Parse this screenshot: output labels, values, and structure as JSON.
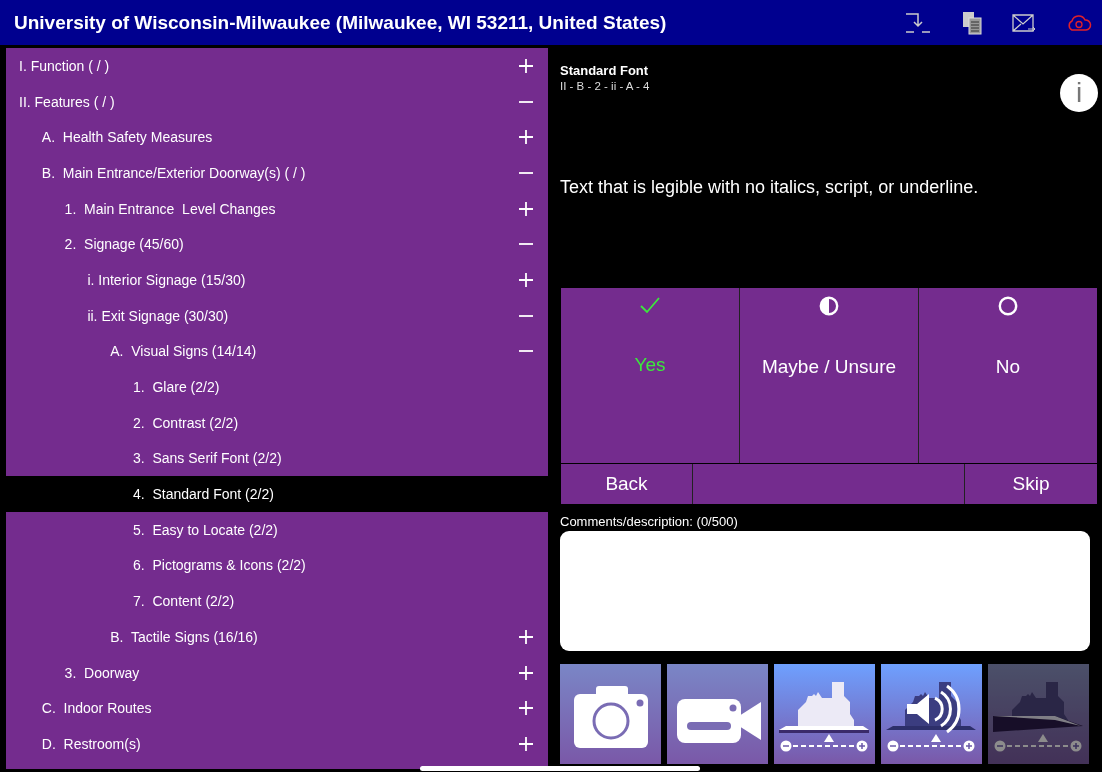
{
  "header": {
    "title": "University of Wisconsin-Milwaukee (Milwaukee, WI 53211, United States)",
    "tools": [
      {
        "kind": "import"
      },
      {
        "kind": "copy"
      },
      {
        "kind": "mail"
      },
      {
        "kind": "sync",
        "alert": true
      }
    ]
  },
  "outline": [
    {
      "label": "I. Function ( / )",
      "expanded": false,
      "selected": false
    },
    {
      "label": "II. Features ( / )",
      "expanded": true,
      "selected": false,
      "children": [
        {
          "label": "A.  Health Safety Measures",
          "expanded": false,
          "selected": false
        },
        {
          "label": "B.  Main Entrance/Exterior Doorway(s) ( / )",
          "expanded": true,
          "selected": false,
          "children": [
            {
              "label": "1.  Main Entrance  Level Changes",
              "expanded": false,
              "selected": false
            },
            {
              "label": "2.  Signage (45/60)",
              "expanded": true,
              "selected": false,
              "children": [
                {
                  "label": "i. Interior Signage (15/30)",
                  "expanded": false,
                  "selected": false
                },
                {
                  "label": "ii. Exit Signage (30/30)",
                  "expanded": true,
                  "selected": false,
                  "children": [
                    {
                      "label": "A.  Visual Signs (14/14)",
                      "expanded": true,
                      "selected": false,
                      "children": [
                        {
                          "label": "1.  Glare (2/2)",
                          "selected": false
                        },
                        {
                          "label": "2.  Contrast (2/2)",
                          "selected": false
                        },
                        {
                          "label": "3.  Sans Serif Font (2/2)",
                          "selected": false
                        },
                        {
                          "label": "4.  Standard Font (2/2)",
                          "selected": true
                        },
                        {
                          "label": "5.  Easy to Locate (2/2)",
                          "selected": false
                        },
                        {
                          "label": "6.  Pictograms & Icons (2/2)",
                          "selected": false
                        },
                        {
                          "label": "7.  Content (2/2)",
                          "selected": false
                        }
                      ]
                    },
                    {
                      "label": "B.  Tactile Signs (16/16)",
                      "expanded": false,
                      "selected": false
                    }
                  ]
                }
              ]
            },
            {
              "label": "3.  Doorway",
              "expanded": false,
              "selected": false
            }
          ]
        },
        {
          "label": "C.  Indoor Routes",
          "expanded": false,
          "selected": false
        },
        {
          "label": "D.  Restroom(s)",
          "expanded": false,
          "selected": false
        }
      ]
    }
  ],
  "question": {
    "title": "Standard Font",
    "path": "II - B - 2 - ii - A - 4",
    "info": "i",
    "text": "Text that is legible with no italics, script, or underline.",
    "answers": [
      {
        "kind": "check",
        "label": "Yes",
        "selected": true
      },
      {
        "kind": "half",
        "label": "Maybe / Unsure",
        "selected": false
      },
      {
        "kind": "circle",
        "label": "No",
        "selected": false
      }
    ],
    "back": "Back",
    "skip": "Skip",
    "comments_label": "Comments/description: (0/500)"
  },
  "media": [
    {
      "kind": "camera",
      "disabled": false
    },
    {
      "kind": "video",
      "disabled": false
    },
    {
      "kind": "brightness",
      "disabled": false
    },
    {
      "kind": "sound",
      "disabled": false
    },
    {
      "kind": "slope",
      "disabled": true
    }
  ]
}
